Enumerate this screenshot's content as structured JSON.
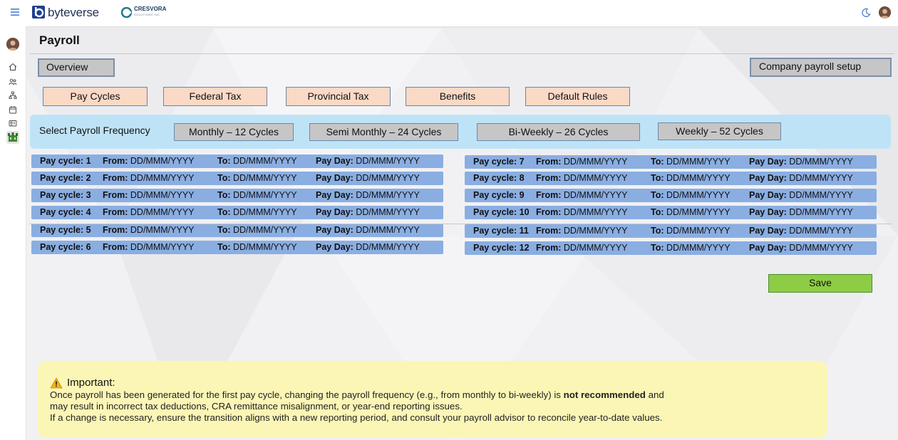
{
  "header": {
    "brand": "byteverse",
    "partner_name": "CRESVORA",
    "partner_sub": "SOLUTIONS INC."
  },
  "page": {
    "title": "Payroll"
  },
  "buttons": {
    "overview": "Overview",
    "company_setup": "Company payroll setup",
    "save": "Save"
  },
  "tabs": [
    "Pay Cycles",
    "Federal Tax",
    "Provincial Tax",
    "Benefits",
    "Default Rules"
  ],
  "frequency": {
    "label": "Select Payroll Frequency",
    "options": [
      "Monthly – 12 Cycles",
      "Semi Monthly – 24 Cycles",
      "Bi-Weekly – 26 Cycles",
      "Weekly – 52 Cycles"
    ]
  },
  "cycle_labels": {
    "from": "From:",
    "to": "To:",
    "pay_day": "Pay Day:",
    "placeholder": "DD/MMM/YYYY"
  },
  "cycles": [
    {
      "label": "Pay cycle: 1"
    },
    {
      "label": "Pay cycle: 2"
    },
    {
      "label": "Pay cycle: 3"
    },
    {
      "label": "Pay cycle: 4"
    },
    {
      "label": "Pay cycle: 5"
    },
    {
      "label": "Pay cycle: 6"
    },
    {
      "label": "Pay cycle: 7"
    },
    {
      "label": "Pay cycle: 8"
    },
    {
      "label": "Pay cycle: 9"
    },
    {
      "label": "Pay cycle: 10"
    },
    {
      "label": "Pay cycle: 11"
    },
    {
      "label": "Pay cycle: 12"
    }
  ],
  "notice": {
    "title": "Important:",
    "line1_pre": "Once payroll has been generated for the first pay cycle, changing the payroll frequency (e.g., from monthly to bi-weekly) is ",
    "line1_bold": "not recommended",
    "line1_post": " and",
    "line2": "may result in incorrect tax deductions, CRA remittance misalignment, or year-end reporting issues.",
    "line3": "If a change is necessary, ensure the transition aligns with a new reporting period, and consult your payroll advisor to reconcile year-to-date values."
  },
  "icons": {
    "menu": "hamburger-menu-icon",
    "theme": "moon-icon",
    "sidebar": [
      "home-icon",
      "users-icon",
      "org-chart-icon",
      "calendar-icon",
      "id-card-icon",
      "payroll-icon"
    ]
  },
  "colors": {
    "tab_bg": "#fad9c6",
    "freq_panel": "#bfe3f6",
    "cycle_row": "#8aaee2",
    "save": "#8ccd45",
    "notice_bg": "#fbf6b6"
  }
}
